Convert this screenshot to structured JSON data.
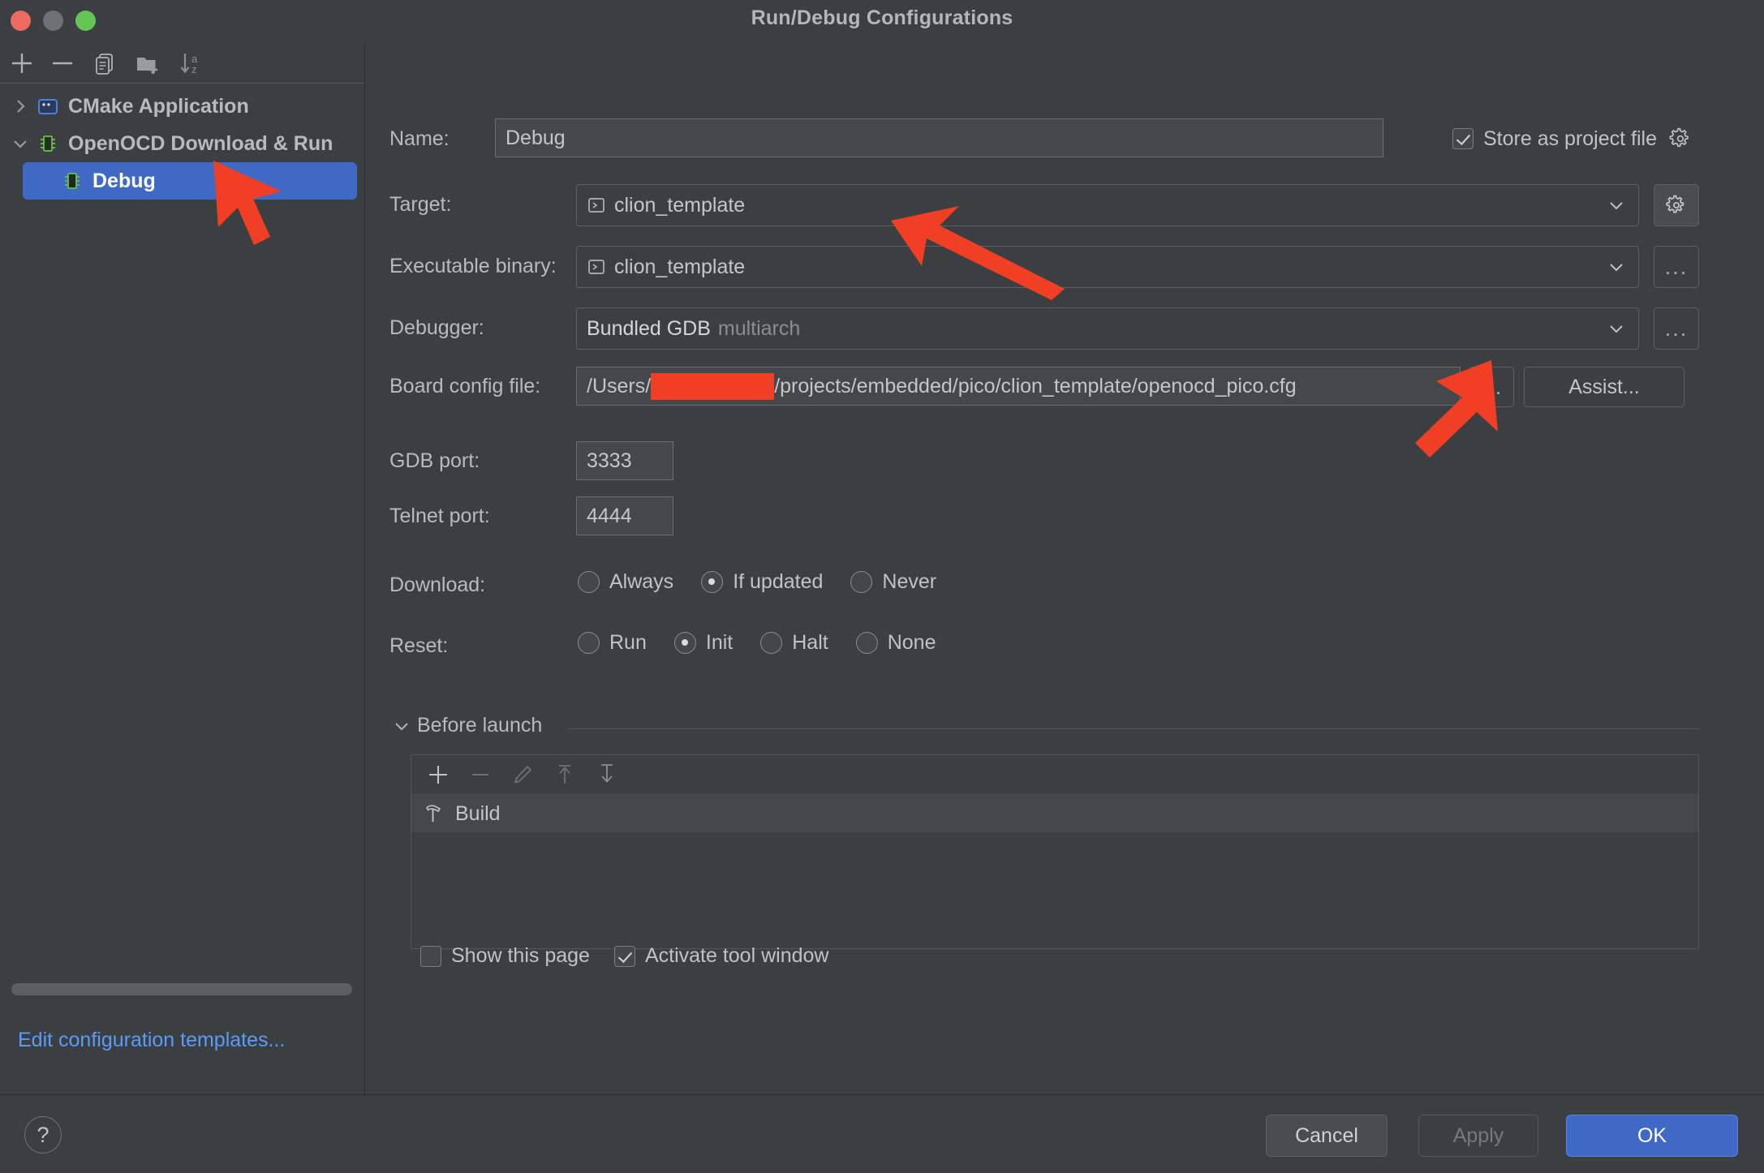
{
  "window": {
    "title": "Run/Debug Configurations",
    "traffic_lights": [
      "close",
      "minimize",
      "maximize"
    ]
  },
  "sidebar": {
    "toolbar": [
      {
        "name": "add-configuration-button",
        "icon": "plus-icon"
      },
      {
        "name": "remove-configuration-button",
        "icon": "minus-icon"
      },
      {
        "name": "copy-configuration-button",
        "icon": "copy-icon"
      },
      {
        "name": "new-folder-button",
        "icon": "folder-add-icon"
      },
      {
        "name": "sort-configurations-button",
        "icon": "sort-az-icon"
      }
    ],
    "tree": [
      {
        "label": "CMake Application",
        "icon": "cmake-application-icon",
        "expanded": false,
        "selected": false,
        "level": 0
      },
      {
        "label": "OpenOCD Download & Run",
        "icon": "microchip-icon",
        "expanded": true,
        "selected": false,
        "level": 0
      },
      {
        "label": "Debug",
        "icon": "microchip-icon",
        "expanded": null,
        "selected": true,
        "level": 1
      }
    ],
    "edit_templates_link": "Edit configuration templates...",
    "link_color": "#5b9bf8",
    "selection_color": "#3f69c4"
  },
  "form": {
    "name": {
      "label": "Name:",
      "value": "Debug"
    },
    "store_as_project_file": {
      "label": "Store as project file",
      "checked": true,
      "gear_icon": "gear-icon"
    },
    "target": {
      "label": "Target:",
      "value": "clion_template",
      "value_icon": "terminal-icon",
      "side_button": "gear-icon"
    },
    "executable_binary": {
      "label": "Executable binary:",
      "value": "clion_template",
      "value_icon": "terminal-icon",
      "side_button": "..."
    },
    "debugger": {
      "label": "Debugger:",
      "value_primary": "Bundled GDB",
      "value_secondary": "multiarch",
      "side_button": "..."
    },
    "board_config_file": {
      "label": "Board config file:",
      "value_prefix": "/Users/",
      "value_redacted": true,
      "value_suffix": "/projects/embedded/pico/clion_template/openocd_pico.cfg",
      "browse_button": "...",
      "assist_button": "Assist..."
    },
    "gdb_port": {
      "label": "GDB port:",
      "value": "3333"
    },
    "telnet_port": {
      "label": "Telnet port:",
      "value": "4444"
    },
    "download": {
      "label": "Download:",
      "options": [
        "Always",
        "If updated",
        "Never"
      ],
      "selected": "If updated"
    },
    "reset": {
      "label": "Reset:",
      "options": [
        "Run",
        "Init",
        "Halt",
        "None"
      ],
      "selected": "Init"
    }
  },
  "before_launch": {
    "title": "Before launch",
    "expanded": true,
    "toolbar": [
      {
        "name": "add-task-button",
        "icon": "plus-icon",
        "enabled": true
      },
      {
        "name": "remove-task-button",
        "icon": "minus-icon",
        "enabled": false
      },
      {
        "name": "edit-task-button",
        "icon": "pencil-icon",
        "enabled": false
      },
      {
        "name": "move-task-up-button",
        "icon": "arrow-up-icon",
        "enabled": false
      },
      {
        "name": "move-task-down-button",
        "icon": "arrow-down-icon",
        "enabled": false
      }
    ],
    "tasks": [
      {
        "label": "Build",
        "icon": "hammer-icon"
      }
    ],
    "show_this_page": {
      "label": "Show this page",
      "checked": false
    },
    "activate_tool_window": {
      "label": "Activate tool window",
      "checked": true
    }
  },
  "footer": {
    "help_label": "?",
    "cancel_label": "Cancel",
    "apply_label": "Apply",
    "apply_enabled": false,
    "ok_label": "OK",
    "ok_color": "#3f69c4"
  },
  "annotations": {
    "arrow_color": "#f03f24",
    "arrows": [
      {
        "name": "arrow-pointing-to-debug-config"
      },
      {
        "name": "arrow-pointing-to-executable-binary"
      },
      {
        "name": "arrow-pointing-to-board-config-file"
      }
    ]
  }
}
